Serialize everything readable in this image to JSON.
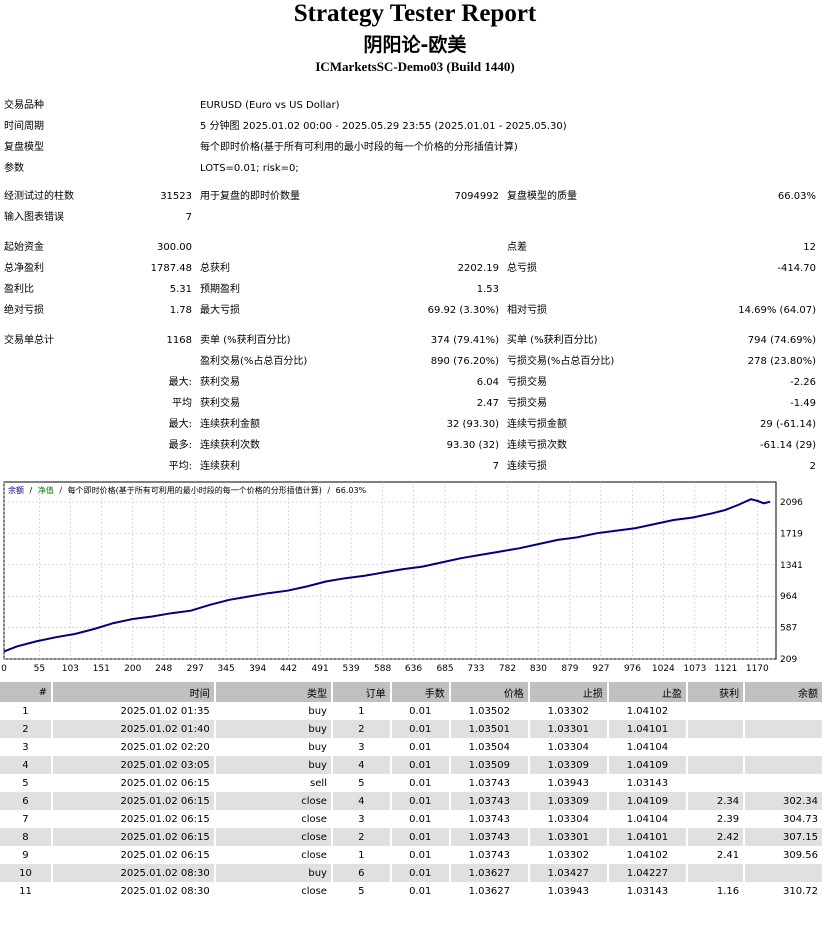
{
  "header": {
    "title": "Strategy Tester Report",
    "ea_name": "阴阳论-欧美",
    "server": "ICMarketsSC-Demo03 (Build 1440)"
  },
  "settings": {
    "symbol_label": "交易品种",
    "symbol_value": "EURUSD (Euro vs US Dollar)",
    "period_label": "时间周期",
    "period_value": "5 分钟图 2025.01.02 00:00 - 2025.05.29 23:55 (2025.01.01 - 2025.05.30)",
    "model_label": "复盘模型",
    "model_value": "每个即时价格(基于所有可利用的最小时段的每一个价格的分形插值计算)",
    "params_label": "参数",
    "params_value": "LOTS=0.01; risk=0;"
  },
  "stats": {
    "bars_label": "经测试过的柱数",
    "bars_value": "31523",
    "ticks_label": "用于复盘的即时价数量",
    "ticks_value": "7094992",
    "quality_label": "复盘模型的质量",
    "quality_value": "66.03%",
    "errors_label": "输入图表错误",
    "errors_value": "7",
    "deposit_label": "起始资金",
    "deposit_value": "300.00",
    "spread_label": "点差",
    "spread_value": "12",
    "net_label": "总净盈利",
    "net_value": "1787.48",
    "gross_profit_label": "总获利",
    "gross_profit_value": "2202.19",
    "gross_loss_label": "总亏损",
    "gross_loss_value": "-414.70",
    "pf_label": "盈利比",
    "pf_value": "5.31",
    "expected_label": "预期盈利",
    "expected_value": "1.53",
    "abs_dd_label": "绝对亏损",
    "abs_dd_value": "1.78",
    "max_dd_label": "最大亏损",
    "max_dd_value": "69.92 (3.30%)",
    "rel_dd_label": "相对亏损",
    "rel_dd_value": "14.69% (64.07)",
    "total_trades_label": "交易单总计",
    "total_trades_value": "1168",
    "short_label": "卖单 (%获利百分比)",
    "short_value": "374 (79.41%)",
    "long_label": "买单 (%获利百分比)",
    "long_value": "794 (74.69%)",
    "win_label": "盈利交易(%占总百分比)",
    "win_value": "890 (76.20%)",
    "loss_label": "亏损交易(%占总百分比)",
    "loss_value": "278 (23.80%)",
    "largest_prefix": "最大:",
    "largest_win_label": "获利交易",
    "largest_win_value": "6.04",
    "largest_loss_label": "亏损交易",
    "largest_loss_value": "-2.26",
    "average_prefix": "平均",
    "avg_win_label": "获利交易",
    "avg_win_value": "2.47",
    "avg_loss_label": "亏损交易",
    "avg_loss_value": "-1.49",
    "max_prefix": "最大:",
    "max_cons_win_label": "连续获利金额",
    "max_cons_win_value": "32 (93.30)",
    "max_cons_loss_label": "连续亏损金额",
    "max_cons_loss_value": "29 (-61.14)",
    "most_prefix": "最多:",
    "most_cons_win_label": "连续获利次数",
    "most_cons_win_value": "93.30 (32)",
    "most_cons_loss_label": "连续亏损次数",
    "most_cons_loss_value": "-61.14 (29)",
    "avg2_prefix": "平均:",
    "avg_cons_win_label": "连续获利",
    "avg_cons_win_value": "7",
    "avg_cons_loss_label": "连续亏损",
    "avg_cons_loss_value": "2"
  },
  "chart_data": {
    "type": "line",
    "legend": {
      "balance": "余额",
      "sep1": "/",
      "equity": "净值",
      "sep2": "/",
      "model": "每个即时价格(基于所有可利用的最小时段的每一个价格的分形插值计算)",
      "sep3": "/",
      "quality": "66.03%"
    },
    "x_ticks": [
      0,
      55,
      103,
      151,
      200,
      248,
      297,
      345,
      394,
      442,
      491,
      539,
      588,
      636,
      685,
      733,
      782,
      830,
      879,
      927,
      976,
      1024,
      1073,
      1121,
      1170
    ],
    "y_ticks": [
      209,
      587,
      964,
      1341,
      1719,
      2096
    ],
    "xlim": [
      0,
      1199
    ],
    "ylim": [
      209,
      2096
    ],
    "grid": true,
    "colors": {
      "balance": "#000080",
      "grid": "#c0c0c0"
    },
    "series": [
      {
        "name": "余额",
        "x": [
          0,
          20,
          50,
          80,
          110,
          140,
          170,
          200,
          230,
          260,
          290,
          320,
          350,
          380,
          410,
          440,
          470,
          500,
          530,
          560,
          590,
          620,
          650,
          680,
          710,
          740,
          770,
          800,
          830,
          860,
          890,
          920,
          950,
          980,
          1010,
          1040,
          1070,
          1100,
          1120,
          1140,
          1160,
          1170,
          1180,
          1190
        ],
        "y": [
          300,
          360,
          420,
          470,
          510,
          570,
          640,
          690,
          720,
          760,
          790,
          860,
          920,
          960,
          1000,
          1030,
          1080,
          1140,
          1180,
          1210,
          1250,
          1290,
          1320,
          1370,
          1420,
          1460,
          1500,
          1540,
          1590,
          1640,
          1670,
          1720,
          1750,
          1780,
          1830,
          1880,
          1910,
          1960,
          2000,
          2060,
          2130,
          2110,
          2080,
          2100
        ]
      }
    ]
  },
  "table": {
    "headers": [
      "#",
      "时间",
      "类型",
      "订单",
      "手数",
      "价格",
      "止损",
      "止盈",
      "获利",
      "余额"
    ],
    "rows": [
      [
        "1",
        "2025.01.02 01:35",
        "buy",
        "1",
        "0.01",
        "1.03502",
        "1.03302",
        "1.04102",
        "",
        ""
      ],
      [
        "2",
        "2025.01.02 01:40",
        "buy",
        "2",
        "0.01",
        "1.03501",
        "1.03301",
        "1.04101",
        "",
        ""
      ],
      [
        "3",
        "2025.01.02 02:20",
        "buy",
        "3",
        "0.01",
        "1.03504",
        "1.03304",
        "1.04104",
        "",
        ""
      ],
      [
        "4",
        "2025.01.02 03:05",
        "buy",
        "4",
        "0.01",
        "1.03509",
        "1.03309",
        "1.04109",
        "",
        ""
      ],
      [
        "5",
        "2025.01.02 06:15",
        "sell",
        "5",
        "0.01",
        "1.03743",
        "1.03943",
        "1.03143",
        "",
        ""
      ],
      [
        "6",
        "2025.01.02 06:15",
        "close",
        "4",
        "0.01",
        "1.03743",
        "1.03309",
        "1.04109",
        "2.34",
        "302.34"
      ],
      [
        "7",
        "2025.01.02 06:15",
        "close",
        "3",
        "0.01",
        "1.03743",
        "1.03304",
        "1.04104",
        "2.39",
        "304.73"
      ],
      [
        "8",
        "2025.01.02 06:15",
        "close",
        "2",
        "0.01",
        "1.03743",
        "1.03301",
        "1.04101",
        "2.42",
        "307.15"
      ],
      [
        "9",
        "2025.01.02 06:15",
        "close",
        "1",
        "0.01",
        "1.03743",
        "1.03302",
        "1.04102",
        "2.41",
        "309.56"
      ],
      [
        "10",
        "2025.01.02 08:30",
        "buy",
        "6",
        "0.01",
        "1.03627",
        "1.03427",
        "1.04227",
        "",
        ""
      ],
      [
        "11",
        "2025.01.02 08:30",
        "close",
        "5",
        "0.01",
        "1.03627",
        "1.03943",
        "1.03143",
        "1.16",
        "310.72"
      ]
    ]
  }
}
